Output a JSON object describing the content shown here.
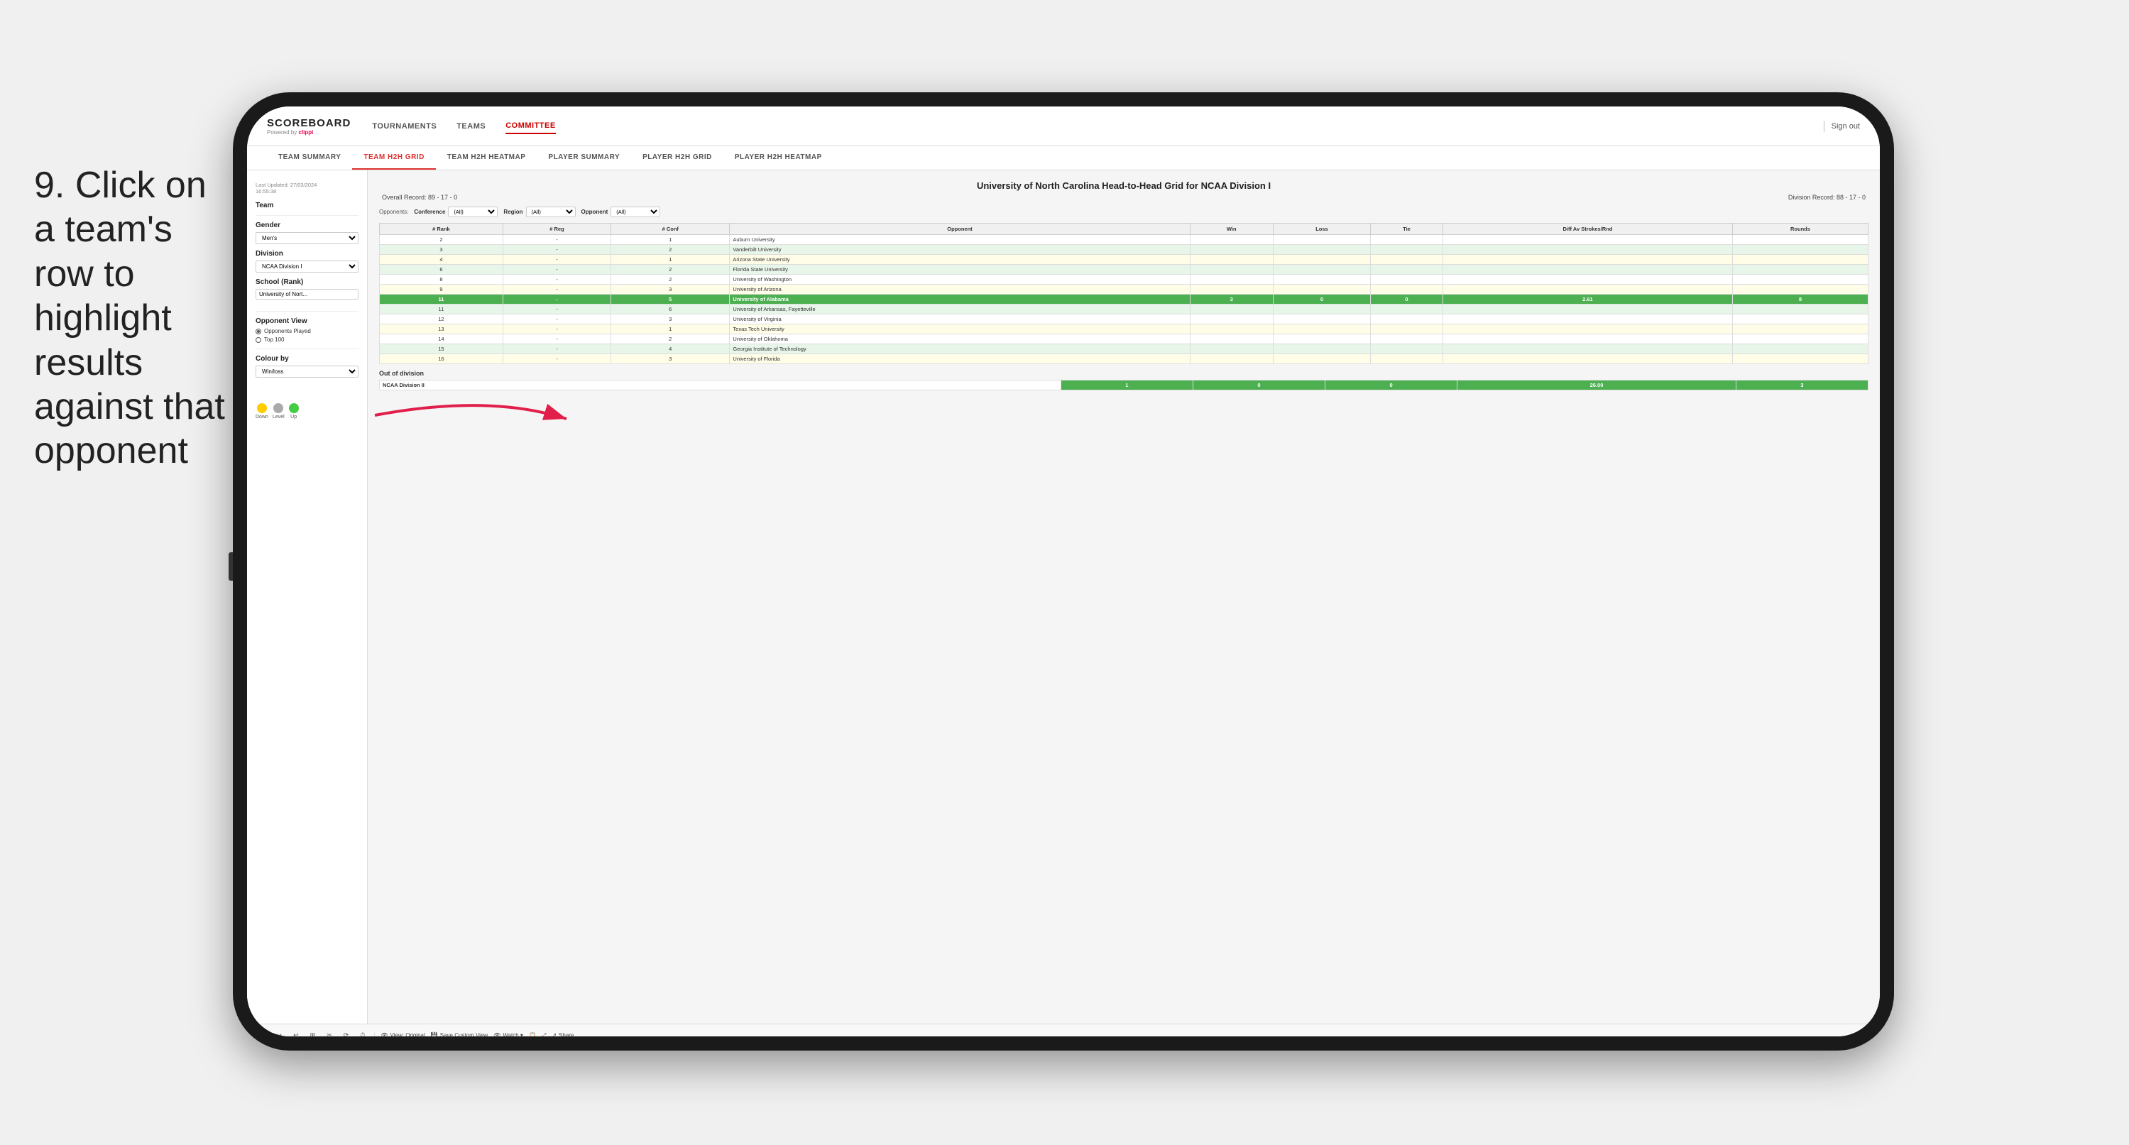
{
  "instruction": {
    "step": "9.",
    "text": "Click on a team's row to highlight results against that opponent"
  },
  "app": {
    "logo": "SCOREBOARD",
    "powered_by": "Powered by",
    "brand": "clippi",
    "sign_out": "Sign out",
    "nav": [
      {
        "label": "TOURNAMENTS",
        "active": false
      },
      {
        "label": "TEAMS",
        "active": false
      },
      {
        "label": "COMMITTEE",
        "active": true
      }
    ],
    "sub_tabs": [
      {
        "label": "TEAM SUMMARY",
        "active": false
      },
      {
        "label": "TEAM H2H GRID",
        "active": true
      },
      {
        "label": "TEAM H2H HEATMAP",
        "active": false
      },
      {
        "label": "PLAYER SUMMARY",
        "active": false
      },
      {
        "label": "PLAYER H2H GRID",
        "active": false
      },
      {
        "label": "PLAYER H2H HEATMAP",
        "active": false
      }
    ]
  },
  "sidebar": {
    "last_updated": "Last Updated: 27/03/2024",
    "time": "16:55:38",
    "team_label": "Team",
    "gender_label": "Gender",
    "gender_value": "Men's",
    "division_label": "Division",
    "division_value": "NCAA Division I",
    "school_label": "School (Rank)",
    "school_value": "University of Nort...",
    "opponent_view_label": "Opponent View",
    "opponent_options": [
      {
        "label": "Opponents Played",
        "selected": true
      },
      {
        "label": "Top 100",
        "selected": false
      }
    ],
    "colour_by_label": "Colour by",
    "colour_by_value": "Win/loss",
    "legend": [
      {
        "label": "Down",
        "color": "#ffcc00"
      },
      {
        "label": "Level",
        "color": "#aaaaaa"
      },
      {
        "label": "Up",
        "color": "#44cc44"
      }
    ]
  },
  "grid": {
    "title": "University of North Carolina Head-to-Head Grid for NCAA Division I",
    "overall_record_label": "Overall Record:",
    "overall_record": "89 - 17 - 0",
    "division_record_label": "Division Record:",
    "division_record": "88 - 17 - 0",
    "filter_label": "Opponents:",
    "filters": [
      {
        "title": "Conference",
        "value": "(All)"
      },
      {
        "title": "Region",
        "value": "(All)"
      },
      {
        "title": "Opponent",
        "value": "(All)"
      }
    ],
    "columns": [
      "# Rank",
      "# Reg",
      "# Conf",
      "Opponent",
      "Win",
      "Loss",
      "Tie",
      "Diff Av Strokes/Rnd",
      "Rounds"
    ],
    "rows": [
      {
        "rank": "2",
        "reg": "-",
        "conf": "1",
        "opponent": "Auburn University",
        "win": "",
        "loss": "",
        "tie": "",
        "diff": "",
        "rounds": "",
        "style": "white"
      },
      {
        "rank": "3",
        "reg": "-",
        "conf": "2",
        "opponent": "Vanderbilt University",
        "win": "",
        "loss": "",
        "tie": "",
        "diff": "",
        "rounds": "",
        "style": "light-green"
      },
      {
        "rank": "4",
        "reg": "-",
        "conf": "1",
        "opponent": "Arizona State University",
        "win": "",
        "loss": "",
        "tie": "",
        "diff": "",
        "rounds": "",
        "style": "light-yellow"
      },
      {
        "rank": "6",
        "reg": "-",
        "conf": "2",
        "opponent": "Florida State University",
        "win": "",
        "loss": "",
        "tie": "",
        "diff": "",
        "rounds": "",
        "style": "light-green"
      },
      {
        "rank": "8",
        "reg": "-",
        "conf": "2",
        "opponent": "University of Washington",
        "win": "",
        "loss": "",
        "tie": "",
        "diff": "",
        "rounds": "",
        "style": "white"
      },
      {
        "rank": "9",
        "reg": "-",
        "conf": "3",
        "opponent": "University of Arizona",
        "win": "",
        "loss": "",
        "tie": "",
        "diff": "",
        "rounds": "",
        "style": "light-yellow"
      },
      {
        "rank": "11",
        "reg": "-",
        "conf": "5",
        "opponent": "University of Alabama",
        "win": "3",
        "loss": "0",
        "tie": "0",
        "diff": "2.61",
        "rounds": "8",
        "style": "highlighted"
      },
      {
        "rank": "11",
        "reg": "-",
        "conf": "6",
        "opponent": "University of Arkansas, Fayetteville",
        "win": "",
        "loss": "",
        "tie": "",
        "diff": "",
        "rounds": "",
        "style": "light-green"
      },
      {
        "rank": "12",
        "reg": "-",
        "conf": "3",
        "opponent": "University of Virginia",
        "win": "",
        "loss": "",
        "tie": "",
        "diff": "",
        "rounds": "",
        "style": "white"
      },
      {
        "rank": "13",
        "reg": "-",
        "conf": "1",
        "opponent": "Texas Tech University",
        "win": "",
        "loss": "",
        "tie": "",
        "diff": "",
        "rounds": "",
        "style": "light-yellow"
      },
      {
        "rank": "14",
        "reg": "-",
        "conf": "2",
        "opponent": "University of Oklahoma",
        "win": "",
        "loss": "",
        "tie": "",
        "diff": "",
        "rounds": "",
        "style": "white"
      },
      {
        "rank": "15",
        "reg": "-",
        "conf": "4",
        "opponent": "Georgia Institute of Technology",
        "win": "",
        "loss": "",
        "tie": "",
        "diff": "",
        "rounds": "",
        "style": "light-green"
      },
      {
        "rank": "16",
        "reg": "-",
        "conf": "3",
        "opponent": "University of Florida",
        "win": "",
        "loss": "",
        "tie": "",
        "diff": "",
        "rounds": "",
        "style": "light-yellow"
      }
    ],
    "out_of_division_label": "Out of division",
    "out_of_division_row": {
      "division": "NCAA Division II",
      "win": "1",
      "loss": "0",
      "tie": "0",
      "diff": "26.00",
      "rounds": "3"
    }
  },
  "toolbar": {
    "actions": [
      "↩",
      "↪",
      "↩",
      "⊞",
      "✂",
      "⟳",
      "⏱",
      "View: Original",
      "Save Custom View",
      "Watch ▾",
      "📋",
      "⤢",
      "Share"
    ]
  }
}
